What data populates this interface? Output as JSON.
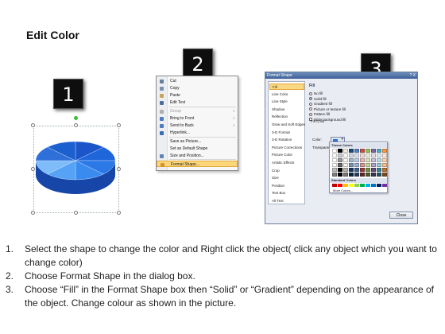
{
  "page": {
    "title": "Edit Color"
  },
  "steps": [
    "1",
    "2",
    "3"
  ],
  "pie": {
    "slice_colors": [
      "#1a55c9",
      "#1f66da",
      "#2b78e6",
      "#3a8bf0",
      "#56a3f5",
      "#7dbcf9",
      "#2f6fd8",
      "#1c5fcf"
    ],
    "side_color": "#1546a8"
  },
  "context_menu": {
    "items": [
      {
        "label": "Cut",
        "icon": "scissors-icon",
        "color": "#6a7f9b"
      },
      {
        "label": "Copy",
        "icon": "copy-icon",
        "color": "#7a8fae"
      },
      {
        "label": "Paste",
        "icon": "paste-icon",
        "color": "#c8a35a"
      },
      {
        "label": "Edit Text",
        "icon": "text-icon",
        "color": "#4e6f9c"
      },
      {
        "label": "Group",
        "icon": "group-icon",
        "color": "#b0b0b0",
        "disabled": true,
        "submenu": true
      },
      {
        "label": "Bring to Front",
        "icon": "bring-front-icon",
        "color": "#4d7cc2",
        "submenu": true
      },
      {
        "label": "Send to Back",
        "icon": "send-back-icon",
        "color": "#4d7cc2",
        "submenu": true
      },
      {
        "label": "Hyperlink...",
        "icon": "hyperlink-icon",
        "color": "#3a6db8"
      },
      {
        "label": "Save as Picture...",
        "icon": "",
        "color": ""
      },
      {
        "label": "Set as Default Shape",
        "icon": "",
        "color": ""
      },
      {
        "label": "Size and Position...",
        "icon": "size-icon",
        "color": "#5e84b8"
      },
      {
        "label": "Format Shape...",
        "icon": "format-shape-icon",
        "color": "#d9902a",
        "active": true
      }
    ]
  },
  "dialog": {
    "title": "Format Shape",
    "window_buttons": "? X",
    "nav": [
      "Fill",
      "Line Color",
      "Line Style",
      "Shadow",
      "Reflection",
      "Glow and Soft Edges",
      "3-D Format",
      "3-D Rotation",
      "Picture Corrections",
      "Picture Color",
      "Artistic Effects",
      "Crop",
      "Size",
      "Position",
      "Text Box",
      "Alt Text"
    ],
    "fill_heading": "Fill",
    "fill_options": [
      "No fill",
      "Solid fill",
      "Gradient fill",
      "Picture or texture fill",
      "Pattern fill",
      "Slide background fill"
    ],
    "selected_fill": 1,
    "fill_color_group": "Fill Color",
    "color_label": "Color:",
    "transparency_label": "Transparency:",
    "close_label": "Close",
    "palette": {
      "theme_heading": "Theme Colors",
      "standard_heading": "Standard Colors",
      "more_colors": "More Colors...",
      "theme_top": [
        "#ffffff",
        "#000000",
        "#eeece1",
        "#1f497d",
        "#4f81bd",
        "#c0504d",
        "#9bbb59",
        "#8064a2",
        "#4bacc6",
        "#f79646"
      ],
      "standard": [
        "#c00000",
        "#ff0000",
        "#ffc000",
        "#ffff00",
        "#92d050",
        "#00b050",
        "#00b0f0",
        "#0070c0",
        "#002060",
        "#7030a0"
      ]
    }
  },
  "instructions": [
    "Select the shape to change the color and Right click the object( click any object which you want to change color)",
    "Choose Format Shape in the dialog box.",
    "Choose “Fill” in the Format Shape box then “Solid” or “Gradient” depending on the appearance of the object. Change colour as shown in the picture."
  ]
}
